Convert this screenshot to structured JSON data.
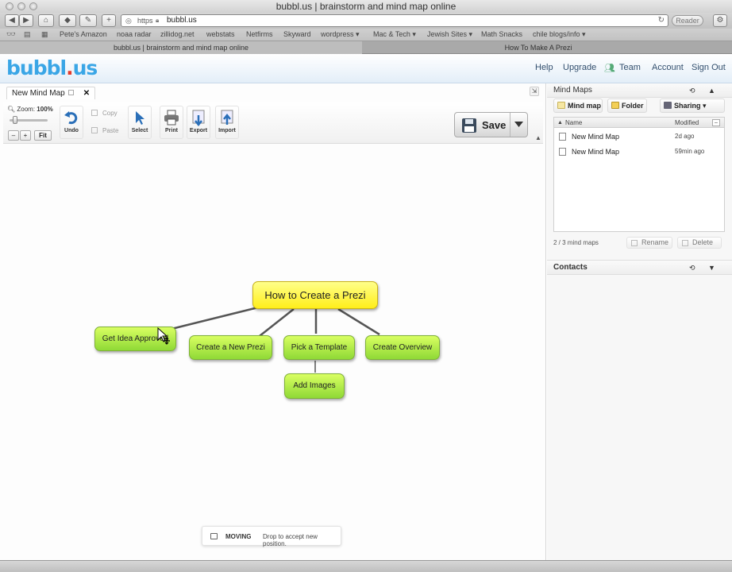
{
  "browser": {
    "window_title": "bubbl.us | brainstorm and mind map online",
    "url_scheme": "https",
    "url": "bubbl.us",
    "reader_label": "Reader",
    "bookmarks": [
      "Pete's Amazon",
      "noaa radar",
      "zillidog.net",
      "webstats",
      "Netfirms",
      "Skyward",
      "wordpress ▾",
      "Mac & Tech ▾",
      "Jewish Sites ▾",
      "Math Snacks",
      "chile blogs/info ▾"
    ],
    "tabs": [
      "bubbl.us | brainstorm and mind map online",
      "How To Make A Prezi"
    ]
  },
  "app": {
    "logo_main": "bubbl",
    "logo_dot": ".",
    "logo_tail": "us",
    "nav": {
      "help": "Help",
      "upgrade": "Upgrade",
      "team": "Team",
      "account": "Account",
      "signout": "Sign Out"
    }
  },
  "editor": {
    "doc_tab": "New Mind Map",
    "zoom_label": "Zoom:",
    "zoom_value": "100%",
    "zoom_minus": "–",
    "zoom_plus": "+",
    "zoom_fit": "Fit",
    "tools": {
      "undo": "Undo",
      "copy": "Copy",
      "paste": "Paste",
      "select": "Select",
      "print": "Print",
      "export": "Export",
      "import": "Import",
      "save": "Save"
    },
    "nodes": {
      "root": "How to Create a Prezi",
      "idea": "Get Idea Approved",
      "new_prezi": "Create a New Prezi",
      "template": "Pick a Template",
      "overview": "Create Overview",
      "images": "Add Images"
    },
    "status": {
      "state": "MOVING",
      "message": "Drop to accept new position."
    }
  },
  "panel": {
    "mindmaps_title": "Mind Maps",
    "tools": {
      "mindmap": "Mind map",
      "folder": "Folder",
      "sharing": "Sharing"
    },
    "columns": {
      "name": "Name",
      "modified": "Modified"
    },
    "files": [
      {
        "name": "New Mind Map",
        "modified": "2d ago"
      },
      {
        "name": "New Mind Map",
        "modified": "59min ago"
      }
    ],
    "count": "2 / 3 mind maps",
    "rename": "Rename",
    "delete": "Delete",
    "contacts_title": "Contacts"
  },
  "colors": {
    "root_fill": "#ffee1a",
    "node_fill": "#8fd936",
    "logo_blue": "#3aa6e6",
    "logo_red": "#e23a2c"
  }
}
